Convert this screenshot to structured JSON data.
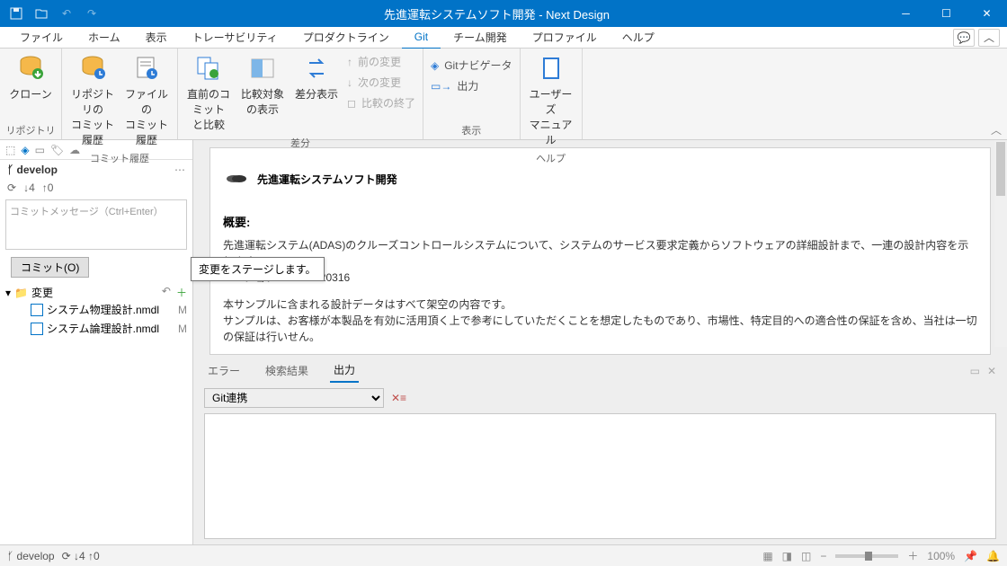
{
  "title": "先進運転システムソフト開発 - Next Design",
  "menubar": [
    "ファイル",
    "ホーム",
    "表示",
    "トレーサビリティ",
    "プロダクトライン",
    "Git",
    "チーム開発",
    "プロファイル",
    "ヘルプ"
  ],
  "menubar_active": 5,
  "ribbon": {
    "groups": [
      {
        "label": "リポジトリ",
        "large": [
          {
            "label": "クローン",
            "icon": "db-down"
          }
        ]
      },
      {
        "label": "コミット履歴",
        "large": [
          {
            "label": "リポジトリの\nコミット履歴",
            "icon": "db-hist"
          },
          {
            "label": "ファイルの\nコミット履歴",
            "icon": "file-hist"
          }
        ]
      },
      {
        "label": "差分",
        "large": [
          {
            "label": "直前のコミット\nと比較",
            "icon": "doc-diff"
          },
          {
            "label": "比較対象\nの表示",
            "icon": "split"
          },
          {
            "label": "差分表示",
            "icon": "swap"
          }
        ],
        "small": [
          {
            "label": "前の変更",
            "dis": true
          },
          {
            "label": "次の変更",
            "dis": true
          },
          {
            "label": "比較の終了",
            "dis": true
          }
        ]
      },
      {
        "label": "表示",
        "small": [
          {
            "label": "Gitナビゲータ",
            "icon": "branch",
            "dis": false
          },
          {
            "label": "出力",
            "icon": "out",
            "dis": false
          }
        ]
      },
      {
        "label": "ヘルプ",
        "large": [
          {
            "label": "ユーザーズ\nマニュアル",
            "icon": "book"
          }
        ]
      }
    ]
  },
  "left": {
    "branch": "develop",
    "down": "4",
    "up": "0",
    "msg_placeholder": "コミットメッセージ（Ctrl+Enter）",
    "commit_btn": "コミット(O)",
    "changes_label": "変更",
    "files": [
      "システム物理設計.nmdl",
      "システム論理設計.nmdl"
    ]
  },
  "tooltip": "変更をステージします。",
  "doc": {
    "title": "先進運転システムソフト開発",
    "h": "概要:",
    "p1": "先進運転システム(ADAS)のクルーズコントロールシステムについて、システムのサービス要求定義からソフトウェアの詳細設計まで、一連の設計内容を示します。",
    "p2": "バージョン:V1.1.2.220316",
    "p3": "本サンプルに含まれる設計データはすべて架空の内容です。",
    "p4": "サンプルは、お客様が本製品を有効に活用頂く上で参考にしていただくことを想定したものであり、市場性、特定目的への適合性の保証を含め、当社は一切の保証は行いせん。"
  },
  "bottom_tabs": [
    "エラー",
    "検索結果",
    "出力"
  ],
  "bottom_active": 2,
  "filter": "Git連携",
  "status": {
    "branch": "develop",
    "down": "4",
    "up": "0",
    "zoom": "100%"
  }
}
